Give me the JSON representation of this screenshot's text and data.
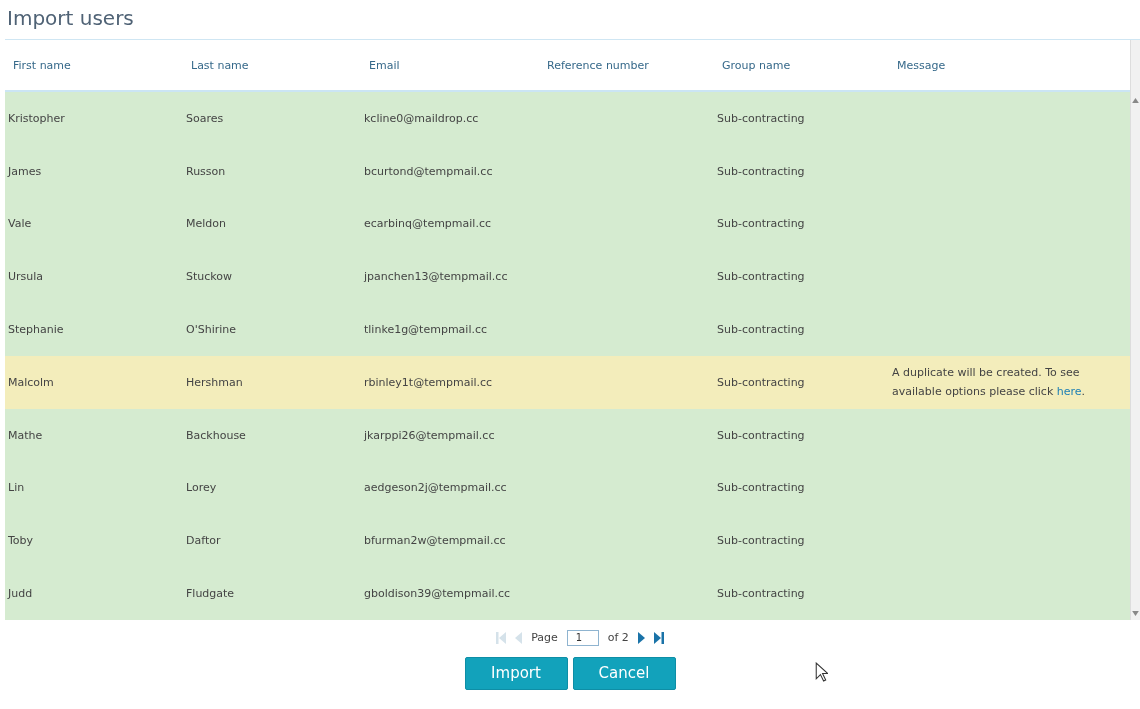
{
  "page": {
    "title": "Import users"
  },
  "table": {
    "columns": [
      "First name",
      "Last name",
      "Email",
      "Reference number",
      "Group name",
      "Message"
    ],
    "rows": [
      {
        "warning": false,
        "first_name": "Kristopher",
        "last_name": "Soares",
        "email": "kcline0@maildrop.cc",
        "group_name": "Sub-contracting"
      },
      {
        "warning": false,
        "first_name": "James",
        "last_name": "Russon",
        "email": "bcurtond@tempmail.cc",
        "group_name": "Sub-contracting"
      },
      {
        "warning": false,
        "first_name": "Vale",
        "last_name": "Meldon",
        "email": "ecarbinq@tempmail.cc",
        "group_name": "Sub-contracting"
      },
      {
        "warning": false,
        "first_name": "Ursula",
        "last_name": "Stuckow",
        "email": "jpanchen13@tempmail.cc",
        "group_name": "Sub-contracting"
      },
      {
        "warning": false,
        "first_name": "Stephanie",
        "last_name": "O'Shirine",
        "email": "tlinke1g@tempmail.cc",
        "group_name": "Sub-contracting"
      },
      {
        "warning": true,
        "first_name": "Malcolm",
        "last_name": "Hershman",
        "email": "rbinley1t@tempmail.cc",
        "group_name": "Sub-contracting",
        "message": {
          "before": "A duplicate will be created. To see available options please click",
          "link": "here",
          "after": "."
        }
      },
      {
        "warning": false,
        "first_name": "Mathe",
        "last_name": "Backhouse",
        "email": "jkarppi26@tempmail.cc",
        "group_name": "Sub-contracting"
      },
      {
        "warning": false,
        "first_name": "Lin",
        "last_name": "Lorey",
        "email": "aedgeson2j@tempmail.cc",
        "group_name": "Sub-contracting"
      },
      {
        "warning": false,
        "first_name": "Toby",
        "last_name": "Daftor",
        "email": "bfurman2w@tempmail.cc",
        "group_name": "Sub-contracting"
      },
      {
        "warning": false,
        "first_name": "Judd",
        "last_name": "Fludgate",
        "email": "gboldison39@tempmail.cc",
        "group_name": "Sub-contracting"
      }
    ]
  },
  "pager": {
    "first_disabled": true,
    "prev_disabled": true,
    "next_disabled": false,
    "last_disabled": false,
    "page_label": "Page",
    "page_value": "1",
    "of_label": "of 2"
  },
  "buttons": [
    {
      "label": "Import"
    },
    {
      "label": "Cancel"
    }
  ]
}
